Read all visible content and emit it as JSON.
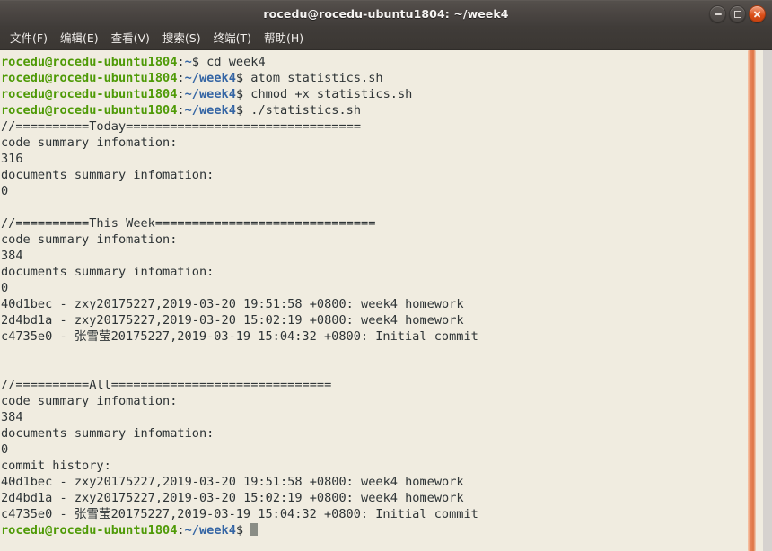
{
  "window": {
    "title": "rocedu@rocedu-ubuntu1804: ~/week4",
    "buttons": {
      "minimize": "minimize",
      "maximize": "maximize",
      "close": "close"
    }
  },
  "menubar": {
    "items": [
      {
        "label": "文件(F)",
        "name": "menu-file"
      },
      {
        "label": "编辑(E)",
        "name": "menu-edit"
      },
      {
        "label": "查看(V)",
        "name": "menu-view"
      },
      {
        "label": "搜索(S)",
        "name": "menu-search"
      },
      {
        "label": "终端(T)",
        "name": "menu-terminal"
      },
      {
        "label": "帮助(H)",
        "name": "menu-help"
      }
    ]
  },
  "terminal": {
    "colors": {
      "background": "#f0ece0",
      "foreground": "#2e3436",
      "prompt_user": "#4e9a06",
      "prompt_path": "#3465a4",
      "cursor": "#8a8d86",
      "scrollbar": "#de7444",
      "titlebar": "#4a4542"
    },
    "prompt_user_host": "rocedu@rocedu-ubuntu1804",
    "commands": [
      {
        "path": "~",
        "command": "cd week4"
      },
      {
        "path": "~/week4",
        "command": "atom statistics.sh"
      },
      {
        "path": "~/week4",
        "command": "chmod +x statistics.sh"
      },
      {
        "path": "~/week4",
        "command": "./statistics.sh"
      }
    ],
    "output_lines": [
      "//==========Today================================",
      "code summary infomation:",
      "316",
      "documents summary infomation:",
      "0",
      "",
      "//==========This Week==============================",
      "code summary infomation:",
      "384",
      "documents summary infomation:",
      "0",
      "40d1bec - zxy20175227,2019-03-20 19:51:58 +0800: week4 homework",
      "2d4bd1a - zxy20175227,2019-03-20 15:02:19 +0800: week4 homework",
      "c4735e0 - 张雪莹20175227,2019-03-19 15:04:32 +0800: Initial commit",
      "",
      "",
      "//==========All==============================",
      "code summary infomation:",
      "384",
      "documents summary infomation:",
      "0",
      "commit history:",
      "40d1bec - zxy20175227,2019-03-20 19:51:58 +0800: week4 homework",
      "2d4bd1a - zxy20175227,2019-03-20 15:02:19 +0800: week4 homework",
      "c4735e0 - 张雪莹20175227,2019-03-19 15:04:32 +0800: Initial commit"
    ],
    "final_prompt": {
      "path": "~/week4",
      "command": ""
    }
  }
}
